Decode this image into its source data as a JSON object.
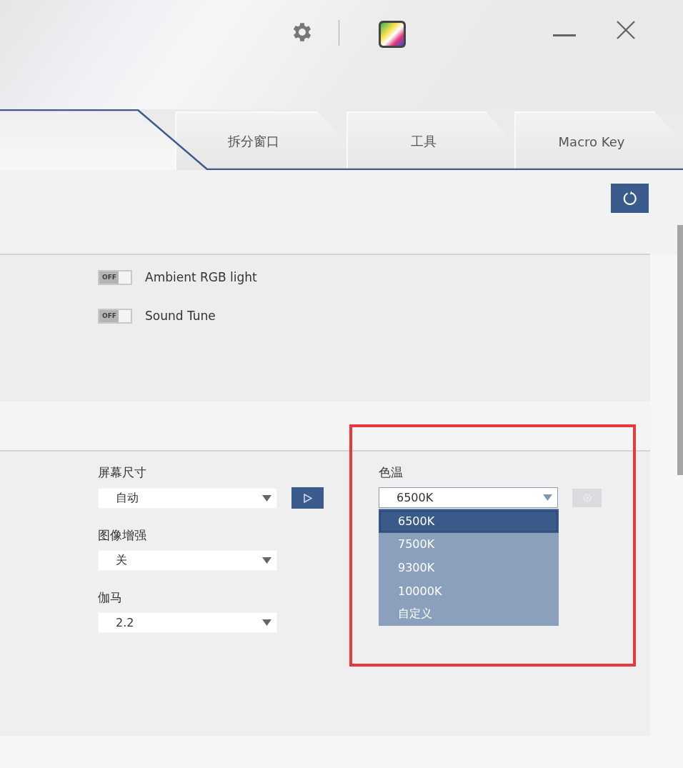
{
  "tabs": [
    {
      "selected": true
    },
    {
      "label": "拆分窗口",
      "selected": false
    },
    {
      "label": "工具",
      "selected": false
    },
    {
      "label": "Macro Key",
      "selected": false
    }
  ],
  "toggles": [
    {
      "label": "Ambient RGB light",
      "state_text": "OFF",
      "on": false
    },
    {
      "label": "Sound Tune",
      "state_text": "OFF",
      "on": false
    }
  ],
  "display_settings": [
    {
      "label": "屏幕尺寸",
      "value": "自动",
      "kind": "with-play"
    },
    {
      "label": "图像增强",
      "value": "关",
      "kind": "plain"
    },
    {
      "label": "伽马",
      "value": "2.2",
      "kind": "plain"
    }
  ],
  "color_temperature": {
    "label": "色温",
    "value": "6500K",
    "expanded": true,
    "settings_disabled": true,
    "options": [
      {
        "label": "6500K",
        "selected": true
      },
      {
        "label": "7500K",
        "selected": false
      },
      {
        "label": "9300K",
        "selected": false
      },
      {
        "label": "10000K",
        "selected": false
      },
      {
        "label": "自定义",
        "selected": false
      }
    ]
  }
}
